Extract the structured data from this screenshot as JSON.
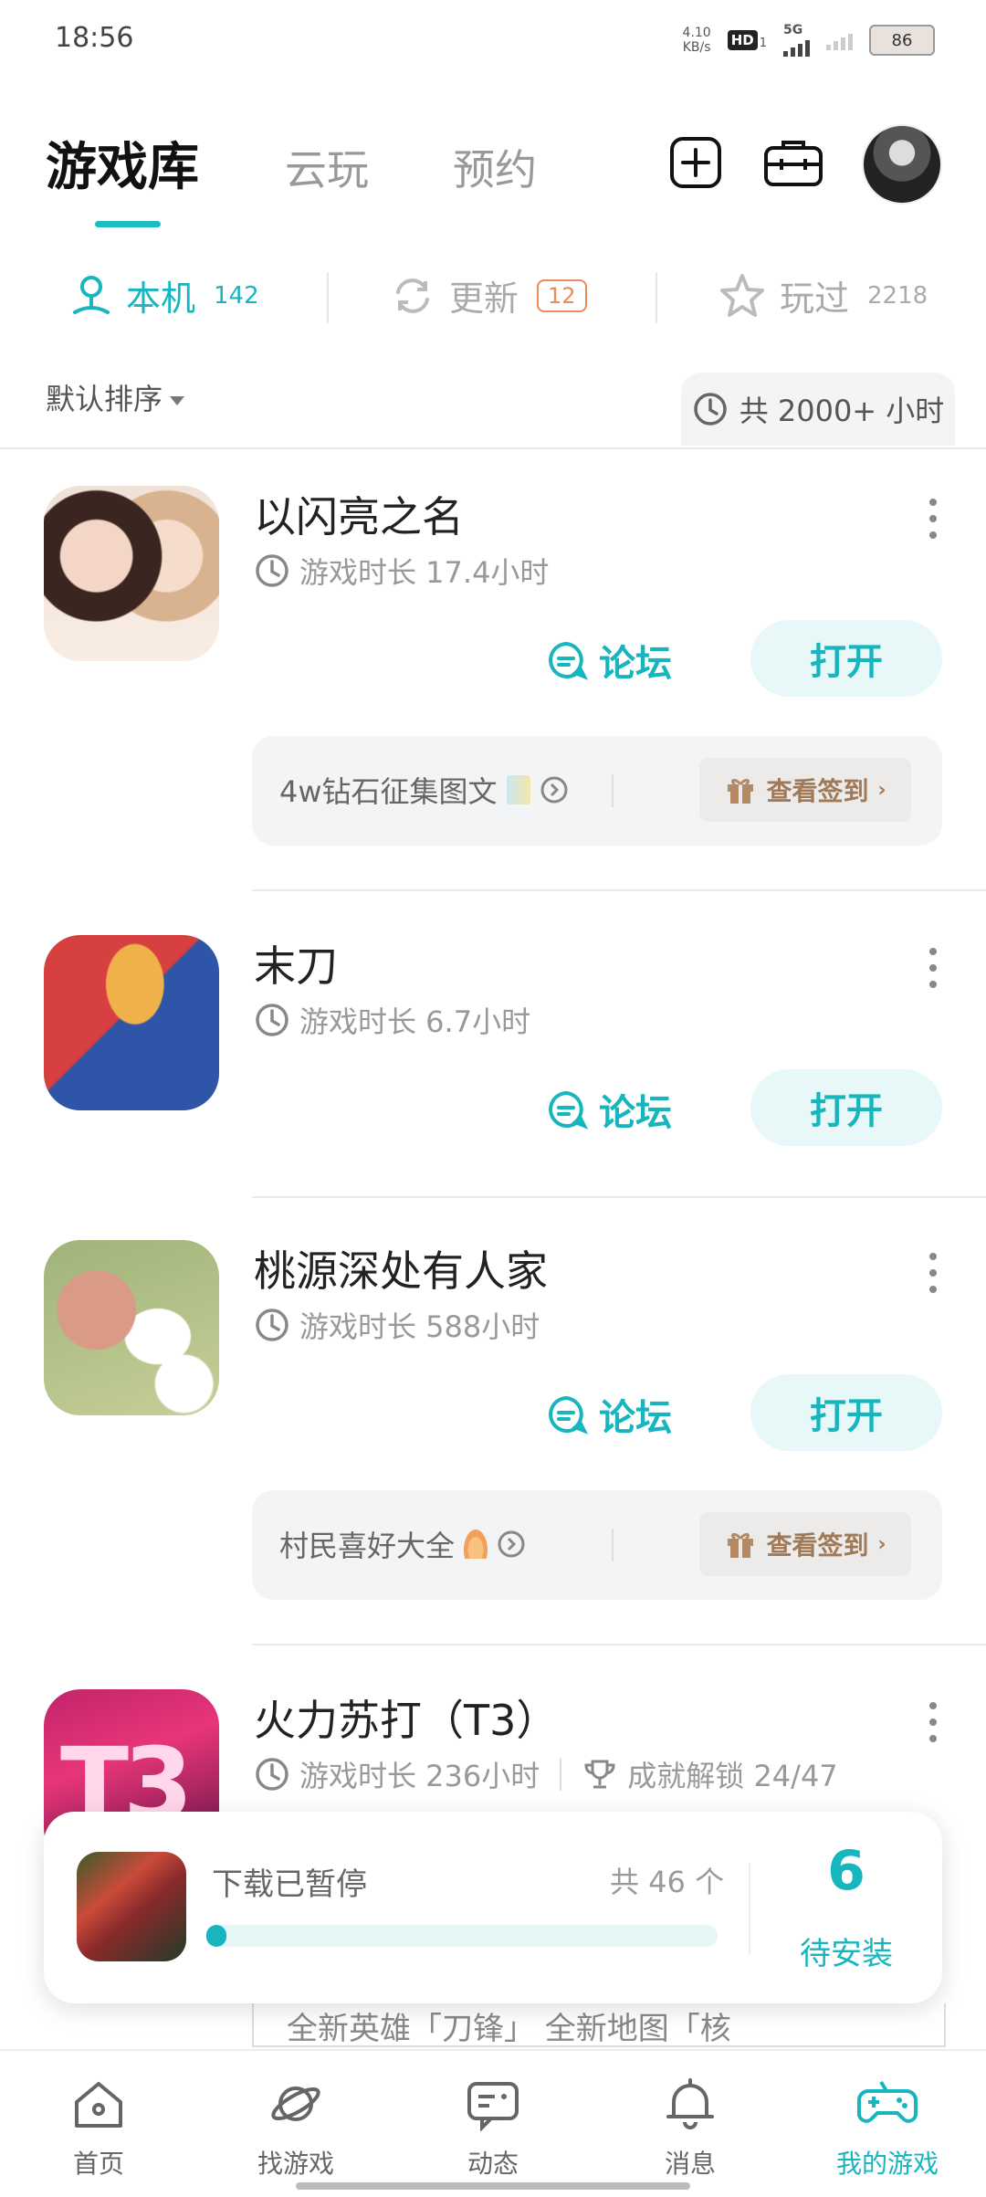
{
  "status_bar": {
    "time": "18:56",
    "net_speed_top": "4.10",
    "net_speed_unit": "KB/s",
    "hd": "HD",
    "hd_sub": "1",
    "network": "5G",
    "battery": "86"
  },
  "header": {
    "tabs": [
      "游戏库",
      "云玩",
      "预约"
    ]
  },
  "sub_tabs": {
    "local_label": "本机",
    "local_count": "142",
    "update_label": "更新",
    "update_count": "12",
    "played_label": "玩过",
    "played_count": "2218"
  },
  "sort_label": "默认排序",
  "total_hours": "共 2000+ 小时",
  "games": [
    {
      "title": "以闪亮之名",
      "playtime": "游戏时长 17.4小时",
      "forum_label": "论坛",
      "open_label": "打开",
      "promo_text": "4w钻石征集图文",
      "signin_label": "查看签到"
    },
    {
      "title": "末刀",
      "playtime": "游戏时长 6.7小时",
      "forum_label": "论坛",
      "open_label": "打开"
    },
    {
      "title": "桃源深处有人家",
      "playtime": "游戏时长 588小时",
      "forum_label": "论坛",
      "open_label": "打开",
      "promo_text": "村民喜好大全",
      "signin_label": "查看签到"
    },
    {
      "title": "火力苏打（T3）",
      "playtime": "游戏时长 236小时",
      "achievement": "成就解锁 24/47"
    }
  ],
  "download": {
    "status": "下载已暂停",
    "total": "共 46 个",
    "count": "6",
    "count_label": "待安装",
    "progress": 0.02
  },
  "underlay_text": "全新英雄「刀锋」 全新地图「核",
  "bottom_nav": [
    "首页",
    "找游戏",
    "动态",
    "消息",
    "我的游戏"
  ],
  "colors": {
    "accent": "#17b6bf",
    "badge_orange": "#e98b5a",
    "signin_brown": "#a07a58"
  }
}
